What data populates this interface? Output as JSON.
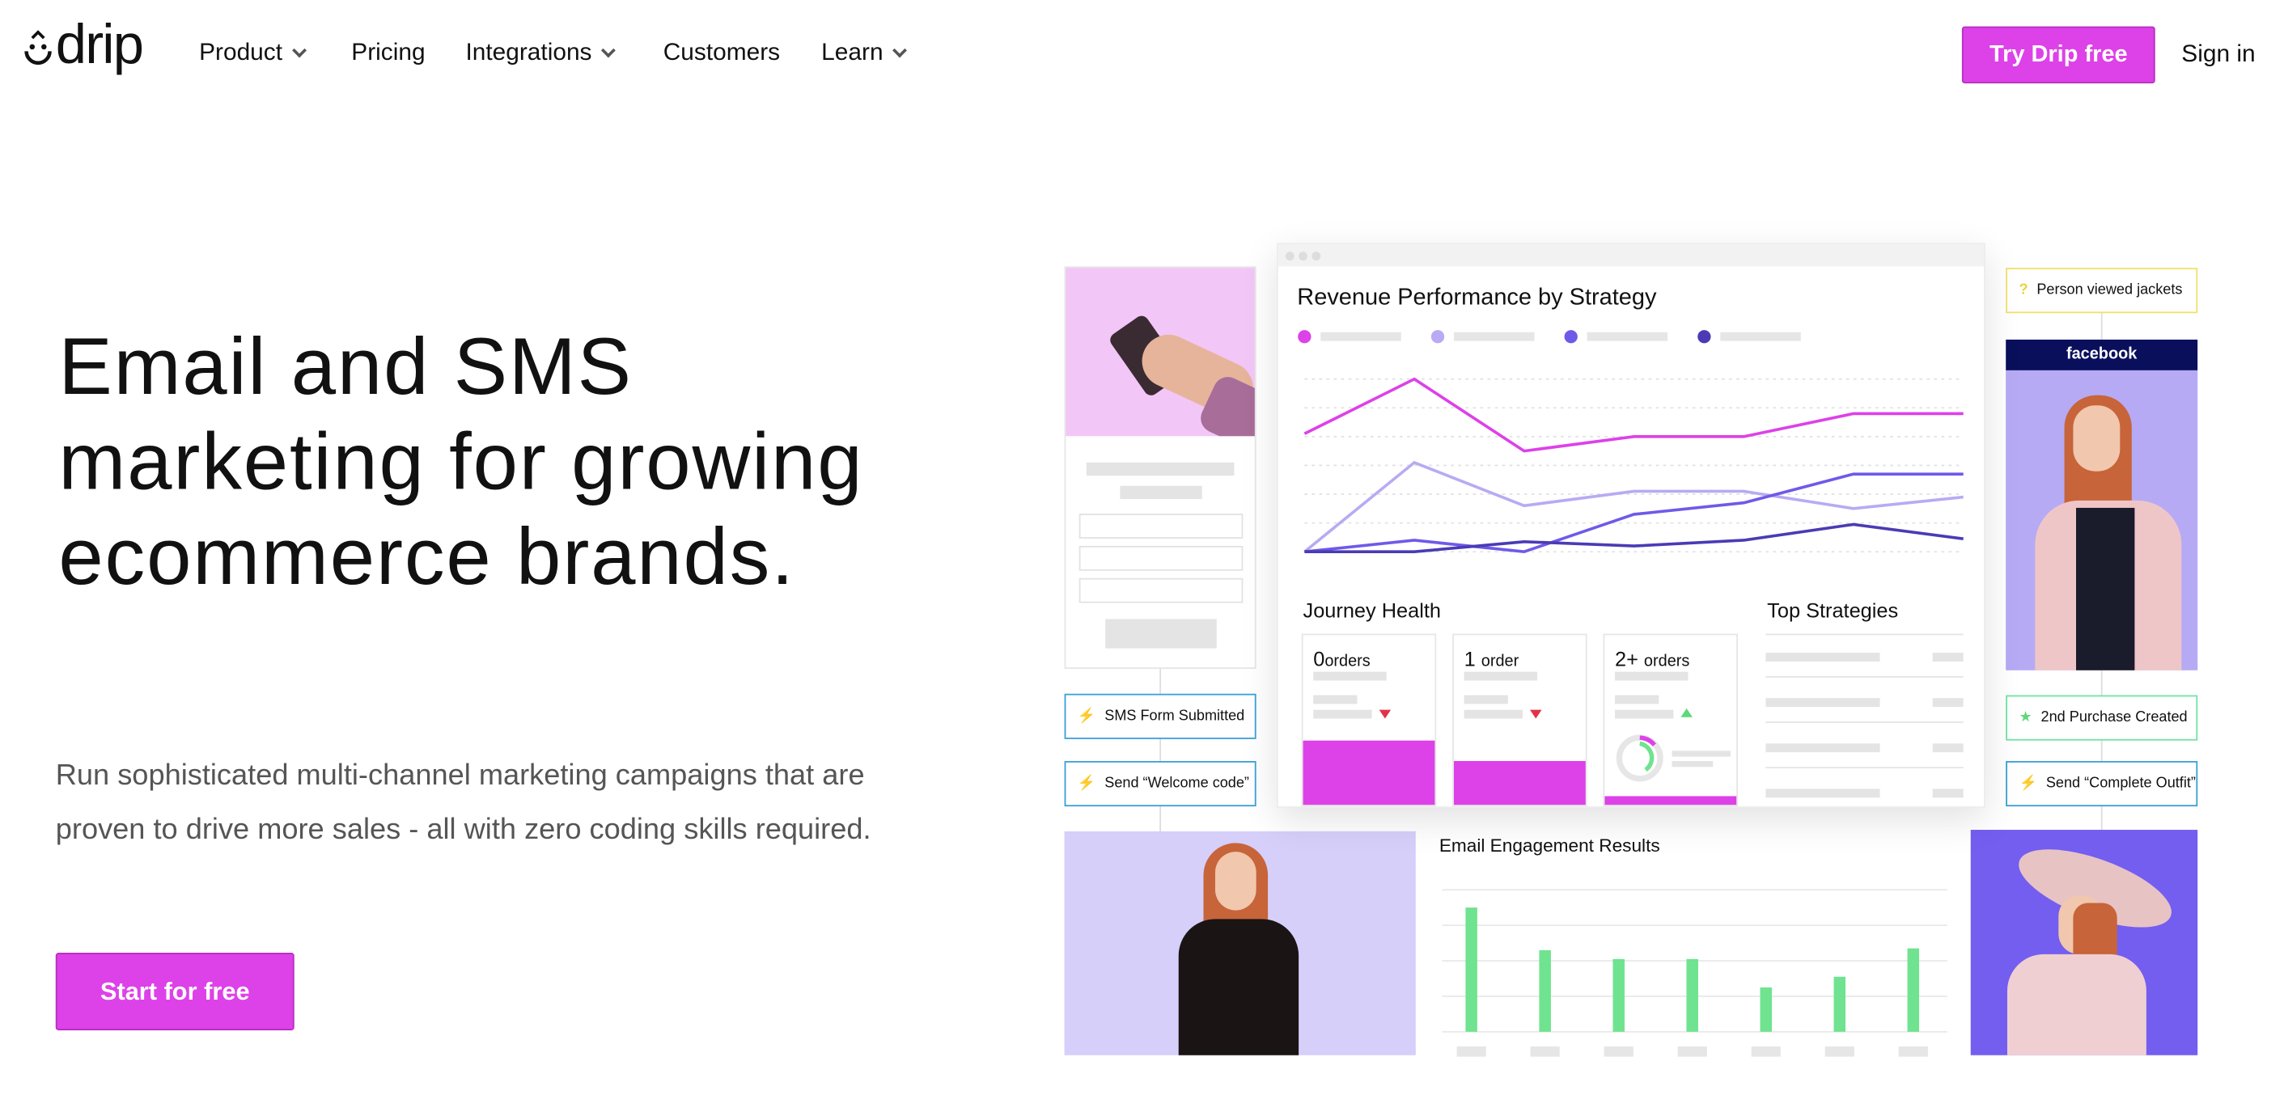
{
  "nav": {
    "logo_text": "drip",
    "items": [
      {
        "label": "Product",
        "has_dropdown": true
      },
      {
        "label": "Pricing",
        "has_dropdown": false
      },
      {
        "label": "Integrations",
        "has_dropdown": true
      },
      {
        "label": "Customers",
        "has_dropdown": false
      },
      {
        "label": "Learn",
        "has_dropdown": true
      }
    ],
    "cta_label": "Try Drip free",
    "signin_label": "Sign in"
  },
  "hero": {
    "title": "Email and SMS marketing for growing ecommerce brands.",
    "subtitle": "Run sophisticated multi-channel marketing campaigns that are proven to drive more sales - all with zero coding skills required.",
    "cta_label": "Start for free"
  },
  "colors": {
    "accent": "#dd41e8",
    "magenta": "#dd41e8",
    "lavender": "#b9aaf3",
    "purple": "#6e5ae8",
    "dark_purple": "#4a3bb5",
    "green": "#6fe38f",
    "facebook_bar": "#0a0f5c"
  },
  "illustration": {
    "flow_tags": {
      "sms_form": "SMS Form Submitted",
      "welcome": "Send “Welcome code”",
      "viewed": "Person viewed jackets",
      "second_purchase": "2nd Purchase Created",
      "outfit": "Send “Complete Outfit”"
    },
    "facebook_label": "facebook",
    "revenue_title": "Revenue Performance by Strategy",
    "journey_title": "Journey Health",
    "journey_cards": [
      {
        "num": "0",
        "unit": "orders",
        "trend": "down"
      },
      {
        "num": "1",
        "unit": "order",
        "trend": "down"
      },
      {
        "num": "2+",
        "unit": "orders",
        "trend": "up"
      }
    ],
    "top_strategies_title": "Top Strategies",
    "engagement_title": "Email Engagement Results"
  },
  "chart_data": [
    {
      "type": "line",
      "title": "Revenue Performance by Strategy",
      "x": [
        1,
        2,
        3,
        4,
        5,
        6,
        7
      ],
      "ylim": [
        0,
        6
      ],
      "grid": true,
      "legend": "top-left",
      "series": [
        {
          "color": "#dd41e8",
          "values": [
            4.1,
            6.0,
            3.5,
            4.0,
            4.0,
            4.8,
            4.8
          ]
        },
        {
          "color": "#b9aaf3",
          "values": [
            0,
            3.1,
            1.6,
            2.1,
            2.1,
            1.5,
            1.9
          ]
        },
        {
          "color": "#6e5ae8",
          "values": [
            0,
            0.4,
            0,
            1.3,
            1.7,
            2.7,
            2.7
          ]
        },
        {
          "color": "#4a3bb5",
          "values": [
            0,
            0,
            0.35,
            0.2,
            0.4,
            0.95,
            0.45
          ]
        }
      ]
    },
    {
      "type": "bar",
      "title": "Email Engagement Results",
      "categories": [
        "",
        "",
        "",
        "",
        "",
        "",
        ""
      ],
      "values": [
        3.5,
        2.3,
        2.05,
        2.05,
        1.25,
        1.55,
        2.35
      ],
      "ylim": [
        0,
        4
      ],
      "grid": true
    }
  ]
}
